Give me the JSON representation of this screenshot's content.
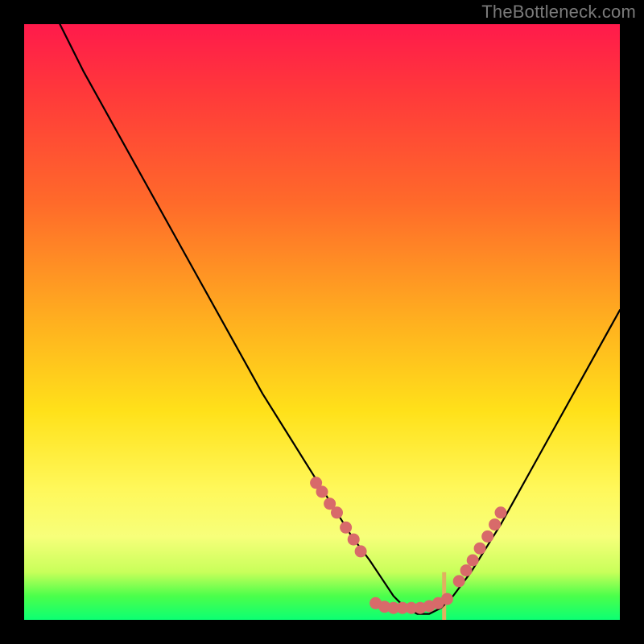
{
  "attribution": "TheBottleneck.com",
  "chart_data": {
    "type": "line",
    "title": "",
    "xlabel": "",
    "ylabel": "",
    "xlim": [
      0,
      100
    ],
    "ylim": [
      0,
      100
    ],
    "grid": false,
    "legend": false,
    "series": [
      {
        "name": "bottleneck-curve",
        "x": [
          6,
          10,
          15,
          20,
          25,
          30,
          35,
          40,
          45,
          50,
          55,
          58,
          60,
          62,
          64,
          66,
          68,
          70,
          72,
          75,
          80,
          85,
          90,
          95,
          100
        ],
        "y": [
          100,
          92,
          83,
          74,
          65,
          56,
          47,
          38,
          30,
          22,
          14,
          10,
          7,
          4,
          2,
          1,
          1,
          2,
          4,
          8,
          16,
          25,
          34,
          43,
          52
        ]
      }
    ],
    "markers": [
      {
        "name": "left-dot-cluster",
        "shape": "circle",
        "color": "#d86a6a",
        "points": [
          {
            "x": 49,
            "y": 23
          },
          {
            "x": 50,
            "y": 21.5
          },
          {
            "x": 51.3,
            "y": 19.5
          },
          {
            "x": 52.5,
            "y": 18
          },
          {
            "x": 54,
            "y": 15.5
          },
          {
            "x": 55.3,
            "y": 13.5
          },
          {
            "x": 56.5,
            "y": 11.5
          }
        ]
      },
      {
        "name": "bottom-dot-cluster",
        "shape": "circle",
        "color": "#d86a6a",
        "points": [
          {
            "x": 59,
            "y": 2.8
          },
          {
            "x": 60.5,
            "y": 2.2
          },
          {
            "x": 62,
            "y": 2
          },
          {
            "x": 63.5,
            "y": 2
          },
          {
            "x": 65,
            "y": 2
          },
          {
            "x": 66.5,
            "y": 2
          },
          {
            "x": 68,
            "y": 2.3
          },
          {
            "x": 69.5,
            "y": 2.8
          },
          {
            "x": 71,
            "y": 3.5
          }
        ]
      },
      {
        "name": "right-dot-cluster",
        "shape": "circle",
        "color": "#d86a6a",
        "points": [
          {
            "x": 73,
            "y": 6.5
          },
          {
            "x": 74.2,
            "y": 8.3
          },
          {
            "x": 75.3,
            "y": 10
          },
          {
            "x": 76.5,
            "y": 12
          },
          {
            "x": 77.8,
            "y": 14
          },
          {
            "x": 79,
            "y": 16
          },
          {
            "x": 80,
            "y": 18
          }
        ]
      }
    ],
    "bars": [
      {
        "name": "marker-bar",
        "color": "#e0b060",
        "x": 70.5,
        "height": 8
      }
    ]
  }
}
